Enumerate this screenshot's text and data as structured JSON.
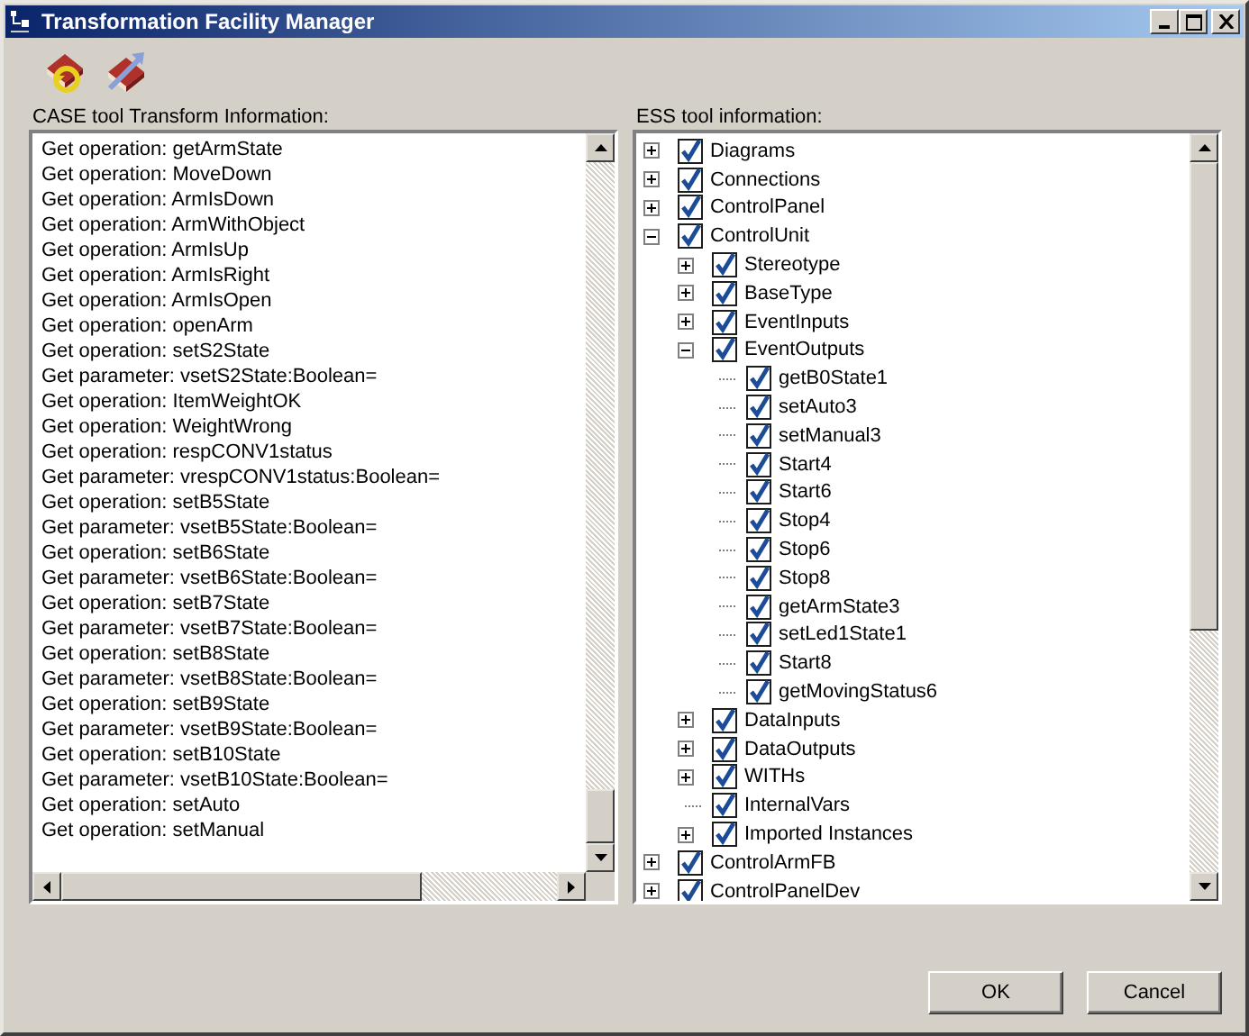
{
  "window": {
    "title": "Transformation Facility Manager"
  },
  "left_panel": {
    "label": "CASE tool Transform Information:",
    "items": [
      "Get operation: getArmState",
      "Get operation: MoveDown",
      "Get operation: ArmIsDown",
      "Get operation: ArmWithObject",
      "Get operation: ArmIsUp",
      "Get operation: ArmIsRight",
      "Get operation: ArmIsOpen",
      "Get operation: openArm",
      "Get operation: setS2State",
      "Get parameter: vsetS2State:Boolean=",
      "Get operation: ItemWeightOK",
      "Get operation: WeightWrong",
      "Get operation: respCONV1status",
      "Get parameter: vrespCONV1status:Boolean=",
      "Get operation: setB5State",
      "Get parameter: vsetB5State:Boolean=",
      "Get operation: setB6State",
      "Get parameter: vsetB6State:Boolean=",
      "Get operation: setB7State",
      "Get parameter: vsetB7State:Boolean=",
      "Get operation: setB8State",
      "Get parameter: vsetB8State:Boolean=",
      "Get operation: setB9State",
      "Get parameter: vsetB9State:Boolean=",
      "Get operation: setB10State",
      "Get parameter: vsetB10State:Boolean=",
      "Get operation: setAuto",
      "Get operation: setManual"
    ]
  },
  "right_panel": {
    "label": "ESS tool information:",
    "tree": [
      {
        "label": "Diagrams",
        "checked": true,
        "expanded": false
      },
      {
        "label": "Connections",
        "checked": true,
        "expanded": false
      },
      {
        "label": "ControlPanel",
        "checked": true,
        "expanded": false
      },
      {
        "label": "ControlUnit",
        "checked": true,
        "expanded": true,
        "children": [
          {
            "label": "Stereotype",
            "checked": true,
            "expanded": false
          },
          {
            "label": "BaseType",
            "checked": true,
            "expanded": false
          },
          {
            "label": "EventInputs",
            "checked": true,
            "expanded": false
          },
          {
            "label": "EventOutputs",
            "checked": true,
            "expanded": true,
            "children": [
              {
                "label": "getB0State1",
                "checked": true
              },
              {
                "label": "setAuto3",
                "checked": true
              },
              {
                "label": "setManual3",
                "checked": true
              },
              {
                "label": "Start4",
                "checked": true
              },
              {
                "label": "Start6",
                "checked": true
              },
              {
                "label": "Stop4",
                "checked": true
              },
              {
                "label": "Stop6",
                "checked": true
              },
              {
                "label": "Stop8",
                "checked": true
              },
              {
                "label": "getArmState3",
                "checked": true
              },
              {
                "label": "setLed1State1",
                "checked": true
              },
              {
                "label": "Start8",
                "checked": true
              },
              {
                "label": "getMovingStatus6",
                "checked": true
              }
            ]
          },
          {
            "label": "DataInputs",
            "checked": true,
            "expanded": false
          },
          {
            "label": "DataOutputs",
            "checked": true,
            "expanded": false
          },
          {
            "label": "WITHs",
            "checked": true,
            "expanded": false
          },
          {
            "label": "InternalVars",
            "checked": true
          },
          {
            "label": "Imported Instances",
            "checked": true,
            "expanded": false
          }
        ]
      },
      {
        "label": "ControlArmFB",
        "checked": true,
        "expanded": false
      },
      {
        "label": "ControlPanelDev",
        "checked": true,
        "expanded": false
      }
    ]
  },
  "buttons": [
    "OK",
    "Cancel"
  ]
}
